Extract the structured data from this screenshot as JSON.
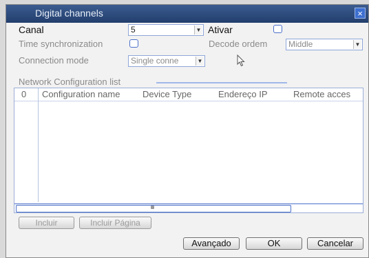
{
  "window": {
    "title": "Digital channels",
    "close_label": "×"
  },
  "form": {
    "canal_label": "Canal",
    "canal_value": "5",
    "ativar_label": "Ativar",
    "time_sync_label": "Time synchronization",
    "decode_order_label": "Decode ordem",
    "decode_order_value": "Middle",
    "connection_mode_label": "Connection mode",
    "connection_mode_value": "Single conne",
    "list_section_label": "Network Configuration list"
  },
  "table": {
    "columns": [
      "0",
      "Configuration name",
      "Device Type",
      "Endereço IP",
      "Remote acces"
    ],
    "rows": []
  },
  "buttons": {
    "incluir": "Incluir",
    "incluir_pagina": "Incluir Página",
    "avancado": "Avançado",
    "ok": "OK",
    "cancelar": "Cancelar"
  },
  "icons": {
    "dropdown_arrow": "▼"
  },
  "colors": {
    "titlebar": "#2f4d80",
    "accent": "#4a6fc8",
    "close": "#3d6fd0"
  }
}
